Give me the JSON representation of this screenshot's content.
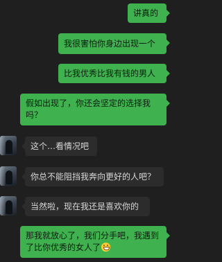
{
  "messages": [
    {
      "side": "me",
      "text": "讲真的"
    },
    {
      "side": "me",
      "text": "我很害怕你身边出现一个"
    },
    {
      "side": "me",
      "text": "比我优秀比我有钱的男人"
    },
    {
      "side": "me",
      "text": "假如出现了，你还会坚定的选择我吗？"
    },
    {
      "side": "them",
      "text": "这个…看情况吧"
    },
    {
      "side": "them",
      "text": "你总不能阻挡我奔向更好的人吧？"
    },
    {
      "side": "them",
      "text": "当然啦，现在我还是喜欢你的"
    },
    {
      "side": "me",
      "text": "那我就放心了，我们分手吧，我遇到了比你优秀的女人了",
      "emoji": "grin-emoji"
    }
  ],
  "colors": {
    "background": "#1f1f1f",
    "outgoing_bubble": "#3fb24f",
    "incoming_bubble": "#2c2c2c"
  }
}
